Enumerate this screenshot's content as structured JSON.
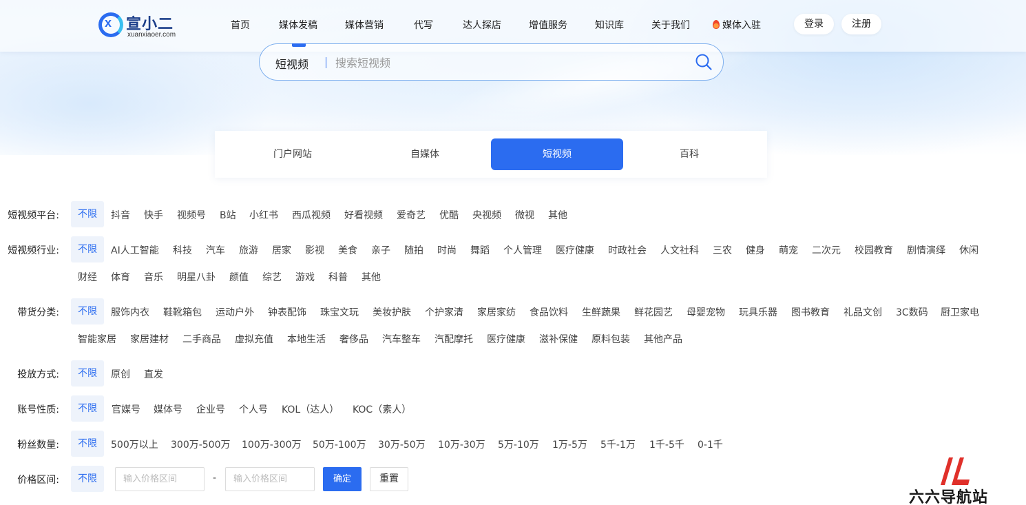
{
  "colors": {
    "accent": "#2b6cf0",
    "any_bg": "#eef3fb",
    "watermark_red": "#e0302a"
  },
  "brand": {
    "name": "宣小二",
    "domain": "xuanxiaoer.com",
    "logo_letter": "x"
  },
  "nav": {
    "items": [
      "首页",
      "媒体发稿",
      "媒体营销",
      "代写",
      "达人探店",
      "增值服务",
      "知识库",
      "关于我们",
      "媒体入驻"
    ],
    "login": "登录",
    "register": "注册"
  },
  "search": {
    "scope": "短视频",
    "placeholder": "搜索短视频"
  },
  "category_tabs": {
    "items": [
      "门户网站",
      "自媒体",
      "短视频",
      "百科"
    ],
    "active": "短视频"
  },
  "filters": {
    "any_label": "不限",
    "platform": {
      "label": "短视频平台:",
      "options": [
        "抖音",
        "快手",
        "视频号",
        "B站",
        "小红书",
        "西瓜视频",
        "好看视频",
        "爱奇艺",
        "优酷",
        "央视频",
        "微视",
        "其他"
      ]
    },
    "industry": {
      "label": "短视频行业:",
      "options": [
        "AI人工智能",
        "科技",
        "汽车",
        "旅游",
        "居家",
        "影视",
        "美食",
        "亲子",
        "随拍",
        "时尚",
        "舞蹈",
        "个人管理",
        "医疗健康",
        "时政社会",
        "人文社科",
        "三农",
        "健身",
        "萌宠",
        "二次元",
        "校园教育",
        "剧情演绎",
        "休闲",
        "财经",
        "体育",
        "音乐",
        "明星八卦",
        "颜值",
        "综艺",
        "游戏",
        "科普",
        "其他"
      ]
    },
    "goods": {
      "label": "带货分类:",
      "options": [
        "服饰内衣",
        "鞋靴箱包",
        "运动户外",
        "钟表配饰",
        "珠宝文玩",
        "美妆护肤",
        "个护家清",
        "家居家纺",
        "食品饮料",
        "生鲜蔬果",
        "鲜花园艺",
        "母婴宠物",
        "玩具乐器",
        "图书教育",
        "礼品文创",
        "3C数码",
        "厨卫家电",
        "智能家居",
        "家居建材",
        "二手商品",
        "虚拟充值",
        "本地生活",
        "奢侈品",
        "汽车整车",
        "汽配摩托",
        "医疗健康",
        "滋补保健",
        "原料包装",
        "其他产品"
      ]
    },
    "placement": {
      "label": "投放方式:",
      "options": [
        "原创",
        "直发"
      ]
    },
    "account": {
      "label": "账号性质:",
      "options": [
        "官媒号",
        "媒体号",
        "企业号",
        "个人号",
        "KOL（达人）",
        "KOC（素人）"
      ]
    },
    "fans": {
      "label": "粉丝数量:",
      "options": [
        "500万以上",
        "300万-500万",
        "100万-300万",
        "50万-100万",
        "30万-50万",
        "10万-30万",
        "5万-10万",
        "1万-5万",
        "5千-1万",
        "1千-5千",
        "0-1千"
      ]
    },
    "price": {
      "label": "价格区间:",
      "min_placeholder": "输入价格区间",
      "max_placeholder": "输入价格区间",
      "dash": "-",
      "confirm": "确定",
      "reset": "重置"
    }
  },
  "watermark": {
    "text": "六六导航站"
  }
}
